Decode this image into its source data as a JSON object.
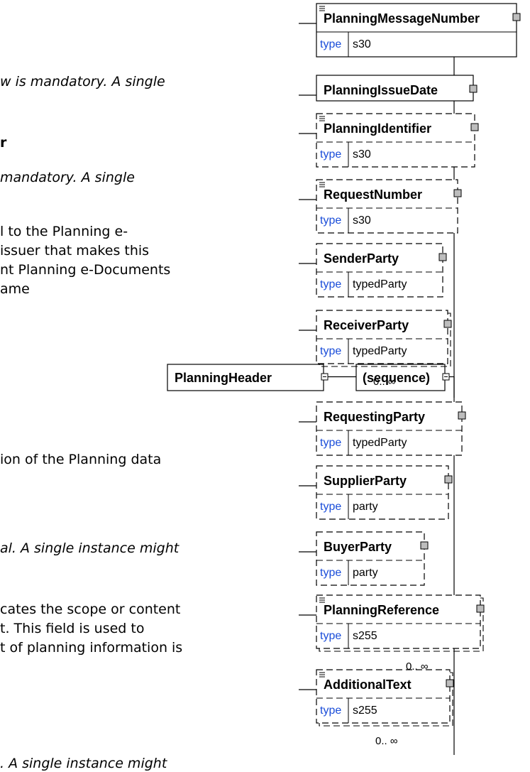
{
  "left_text": [
    {
      "text": "w is mandatory. A single",
      "italic": true,
      "bold": false,
      "x": 0,
      "y": 0
    },
    {
      "text": "r",
      "italic": false,
      "bold": true
    },
    {
      "text": " mandatory. A single",
      "italic": true,
      "bold": false
    },
    {
      "text": "l to the Planning e-",
      "italic": false,
      "bold": false
    },
    {
      "text": "issuer that makes this",
      "italic": false,
      "bold": false
    },
    {
      "text": "nt Planning e-Documents",
      "italic": false,
      "bold": false
    },
    {
      "text": "ame",
      "italic": false,
      "bold": false
    },
    {
      "text": "ion of the Planning data",
      "italic": false,
      "bold": false
    },
    {
      "text": "al. A single instance might",
      "italic": true,
      "bold": false
    },
    {
      "text": "cates the scope or content",
      "italic": false,
      "bold": false
    },
    {
      "text": "t. This field is used to",
      "italic": false,
      "bold": false
    },
    {
      "text": "t of planning information is",
      "italic": false,
      "bold": false
    },
    {
      "text": ". A single instance might",
      "italic": true,
      "bold": false
    }
  ],
  "root": {
    "name": "PlanningHeader"
  },
  "compositor": {
    "name": "(sequence)"
  },
  "type_label": "type",
  "elements": [
    {
      "name": "PlanningMessageNumber",
      "type": "s30",
      "optional": false,
      "doc": true,
      "multiplicity": ""
    },
    {
      "name": "PlanningIssueDate",
      "type": "",
      "optional": false,
      "doc": false,
      "multiplicity": ""
    },
    {
      "name": "PlanningIdentifier",
      "type": "s30",
      "optional": true,
      "doc": true,
      "multiplicity": ""
    },
    {
      "name": "RequestNumber",
      "type": "s30",
      "optional": true,
      "doc": true,
      "multiplicity": ""
    },
    {
      "name": "SenderParty",
      "type": "typedParty",
      "optional": true,
      "doc": false,
      "multiplicity": ""
    },
    {
      "name": "ReceiverParty",
      "type": "typedParty",
      "optional": true,
      "doc": false,
      "multiplicity": "0.. ∞"
    },
    {
      "name": "RequestingParty",
      "type": "typedParty",
      "optional": true,
      "doc": false,
      "multiplicity": ""
    },
    {
      "name": "SupplierParty",
      "type": "party",
      "optional": true,
      "doc": false,
      "multiplicity": ""
    },
    {
      "name": "BuyerParty",
      "type": "party",
      "optional": true,
      "doc": false,
      "multiplicity": ""
    },
    {
      "name": "PlanningReference",
      "type": "s255",
      "optional": true,
      "doc": true,
      "multiplicity": "0.. ∞"
    },
    {
      "name": "AdditionalText",
      "type": "s255",
      "optional": true,
      "doc": true,
      "multiplicity": "0.. ∞"
    }
  ]
}
